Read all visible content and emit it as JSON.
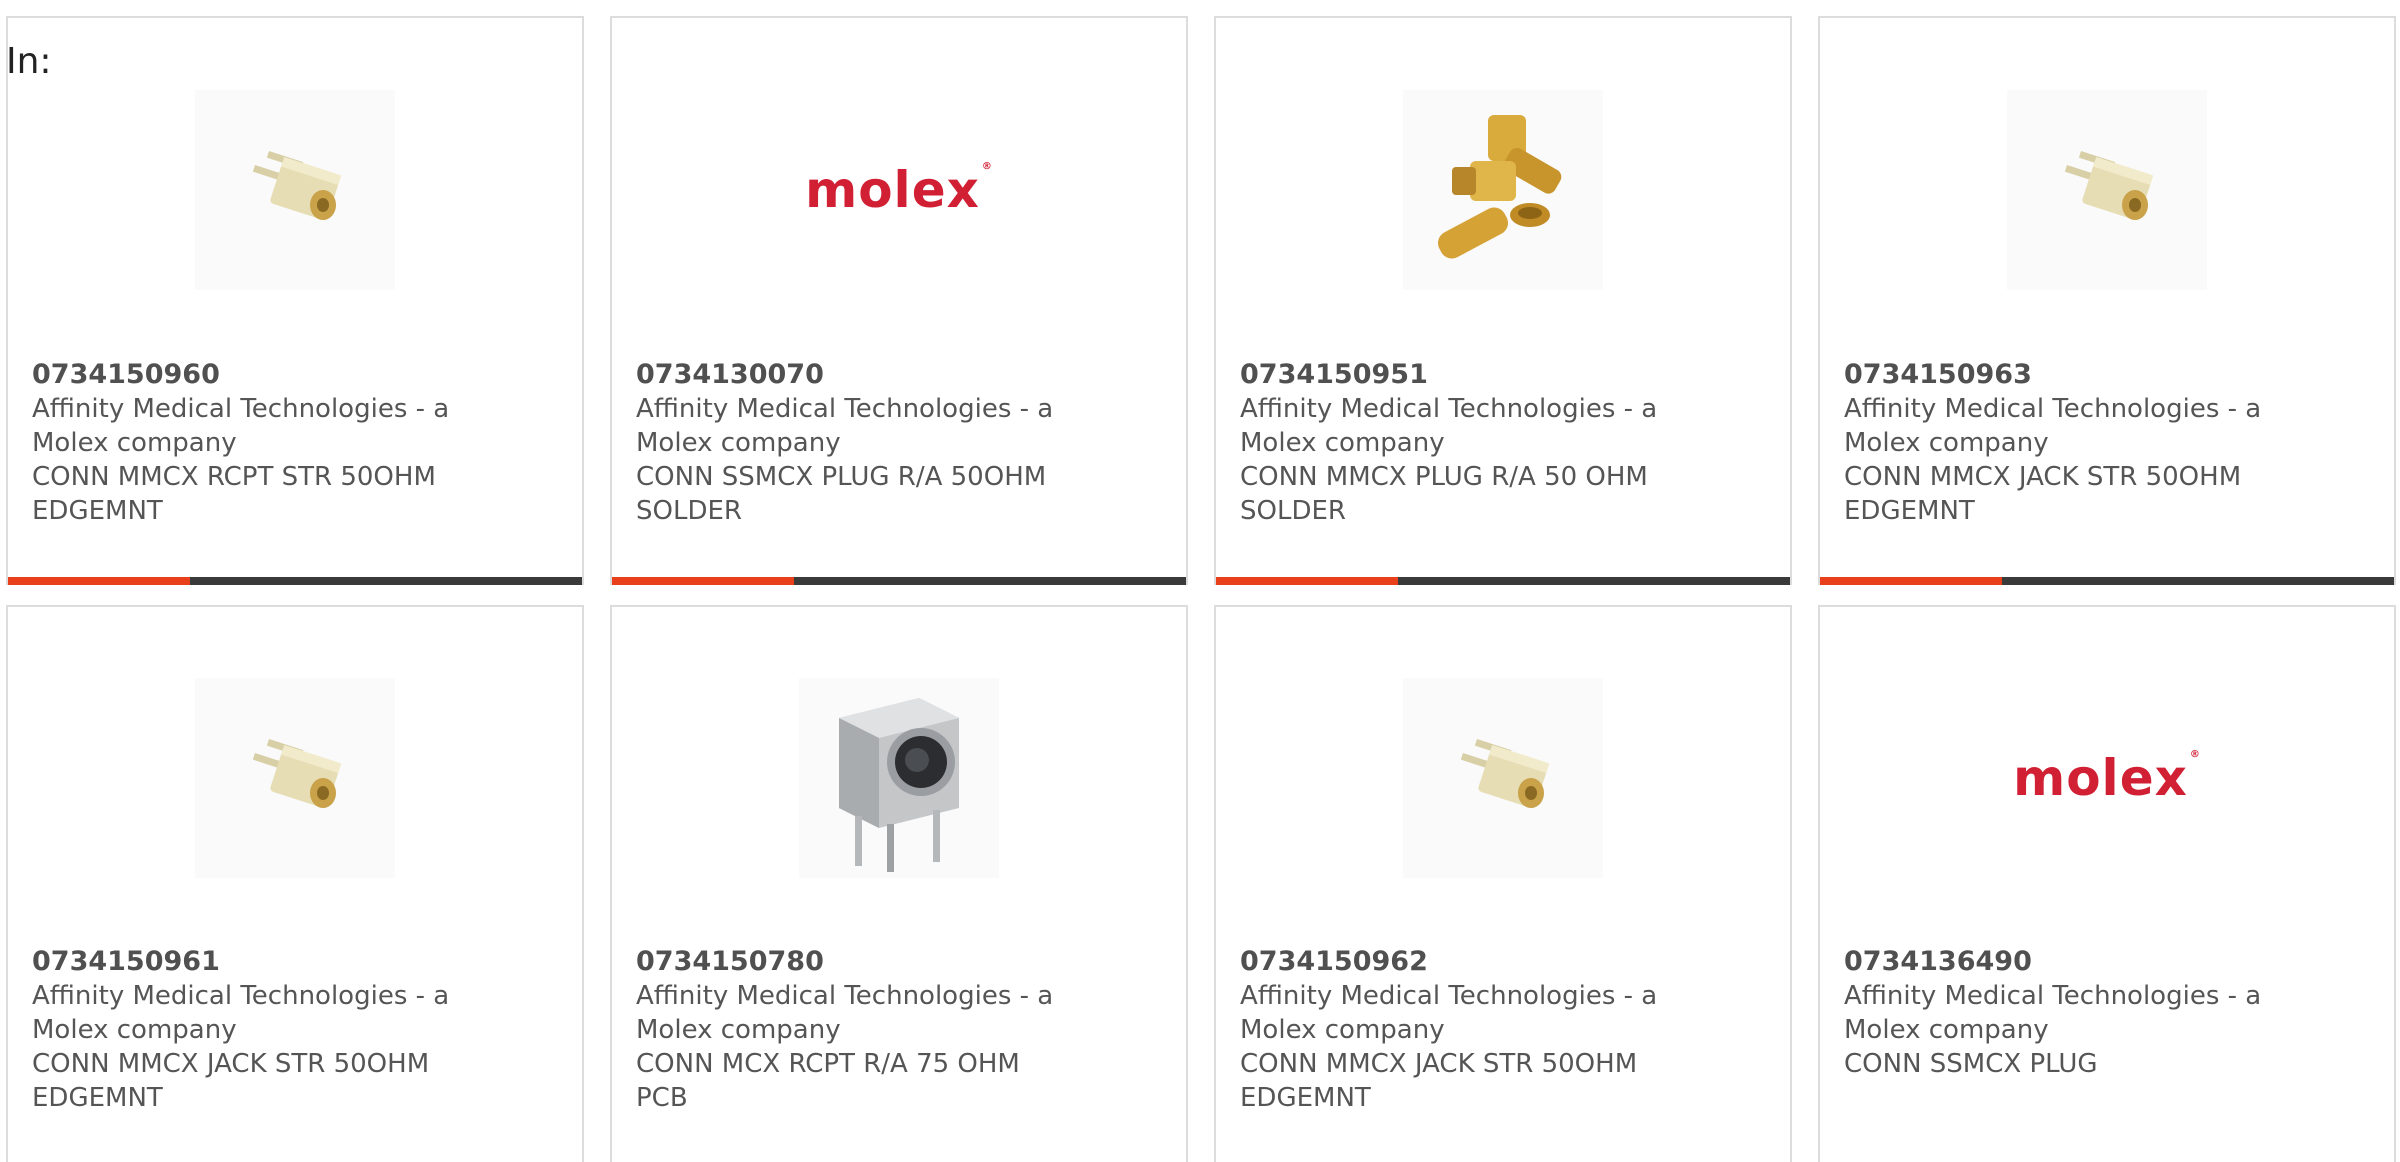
{
  "filter_label": "In:",
  "colors": {
    "accent": "#e8401a",
    "bar": "#3a3a3a",
    "brand": "#d11f34"
  },
  "products": [
    {
      "part": "0734150960",
      "manufacturer": "Affinity Medical Technologies - a Molex company",
      "description": "CONN MMCX RCPT STR 50OHM EDGEMNT",
      "image": "mmcx-edge-connector-icon"
    },
    {
      "part": "0734130070",
      "manufacturer": "Affinity Medical Technologies - a Molex company",
      "description": "CONN SSMCX PLUG R/A 50OHM SOLDER",
      "image": "molex-logo",
      "logo_text": "molex"
    },
    {
      "part": "0734150951",
      "manufacturer": "Affinity Medical Technologies - a Molex company",
      "description": "CONN MMCX PLUG R/A 50 OHM SOLDER",
      "image": "gold-right-angle-plug-icon"
    },
    {
      "part": "0734150963",
      "manufacturer": "Affinity Medical Technologies - a Molex company",
      "description": "CONN MMCX JACK STR 50OHM EDGEMNT",
      "image": "mmcx-edge-connector-icon"
    },
    {
      "part": "0734150961",
      "manufacturer": "Affinity Medical Technologies - a Molex company",
      "description": "CONN MMCX JACK STR 50OHM EDGEMNT",
      "image": "mmcx-edge-connector-icon"
    },
    {
      "part": "0734150780",
      "manufacturer": "Affinity Medical Technologies - a Molex company",
      "description": "CONN MCX RCPT R/A 75 OHM PCB",
      "image": "pcb-right-angle-receptacle-icon"
    },
    {
      "part": "0734150962",
      "manufacturer": "Affinity Medical Technologies - a Molex company",
      "description": "CONN MMCX JACK STR 50OHM EDGEMNT",
      "image": "mmcx-edge-connector-icon"
    },
    {
      "part": "0734136490",
      "manufacturer": "Affinity Medical Technologies - a Molex company",
      "description": "CONN SSMCX PLUG",
      "image": "molex-logo",
      "logo_text": "molex"
    }
  ]
}
